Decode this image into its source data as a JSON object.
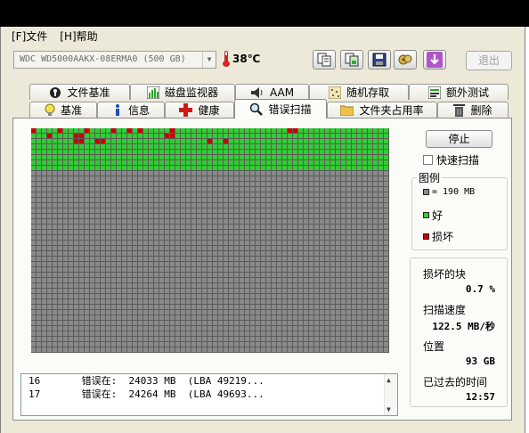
{
  "menu": {
    "file": "[F]文件",
    "help": "[H]帮助"
  },
  "toolbar": {
    "drive": "WDC WD5000AAKX-08ERMA0 (500 GB)",
    "temperature": "38℃",
    "exit_label": "退出",
    "icons": [
      "copy-text-icon",
      "copy-image-icon",
      "save-icon",
      "options-icon",
      "download-icon"
    ]
  },
  "tabs_top": [
    {
      "label": "文件基准",
      "icon": "file-benchmark-icon"
    },
    {
      "label": "磁盘监视器",
      "icon": "disk-monitor-icon"
    },
    {
      "label": "AAM",
      "icon": "speaker-icon"
    },
    {
      "label": "随机存取",
      "icon": "random-access-icon"
    },
    {
      "label": "额外测试",
      "icon": "extra-tests-icon"
    }
  ],
  "tabs_bottom": [
    {
      "label": "基准",
      "icon": "lightbulb-icon"
    },
    {
      "label": "信息",
      "icon": "info-icon"
    },
    {
      "label": "健康",
      "icon": "health-cross-icon"
    },
    {
      "label": "错误扫描",
      "icon": "magnifier-icon",
      "active": true
    },
    {
      "label": "文件夹占用率",
      "icon": "folder-icon"
    },
    {
      "label": "删除",
      "icon": "trash-icon"
    }
  ],
  "scan": {
    "grid": {
      "rows": 42,
      "cols": 67,
      "colors": {
        "good": "#33cc33",
        "bad": "#cc0000",
        "unscanned": "#8a8a8a"
      },
      "scanned_rows": 8,
      "bad_blocks": [
        [
          0,
          0
        ],
        [
          1,
          3
        ],
        [
          0,
          5
        ],
        [
          1,
          8
        ],
        [
          1,
          9
        ],
        [
          0,
          10
        ],
        [
          2,
          8
        ],
        [
          2,
          9
        ],
        [
          2,
          12
        ],
        [
          2,
          13
        ],
        [
          0,
          15
        ],
        [
          0,
          18
        ],
        [
          0,
          20
        ],
        [
          1,
          25
        ],
        [
          0,
          26
        ],
        [
          1,
          26
        ],
        [
          2,
          33
        ],
        [
          2,
          36
        ],
        [
          0,
          48
        ],
        [
          0,
          49
        ]
      ]
    },
    "log": [
      {
        "n": "16",
        "text": "错误在:  24033 MB  (LBA 49219..."
      },
      {
        "n": "17",
        "text": "错误在:  24264 MB  (LBA 49693..."
      }
    ],
    "stop_label": "停止",
    "quick_scan_label": "快速扫描",
    "quick_scan_checked": false,
    "legend": {
      "title": "图例",
      "block_size": "= 190 MB",
      "good": "好",
      "bad": "损坏"
    },
    "stats": {
      "damaged_label": "损坏的块",
      "damaged_value": "0.7 %",
      "speed_label": "扫描速度",
      "speed_value": "122.5 MB/秒",
      "position_label": "位置",
      "position_value": "93 GB",
      "elapsed_label": "已过去的时间",
      "elapsed_value": "12:57"
    }
  }
}
